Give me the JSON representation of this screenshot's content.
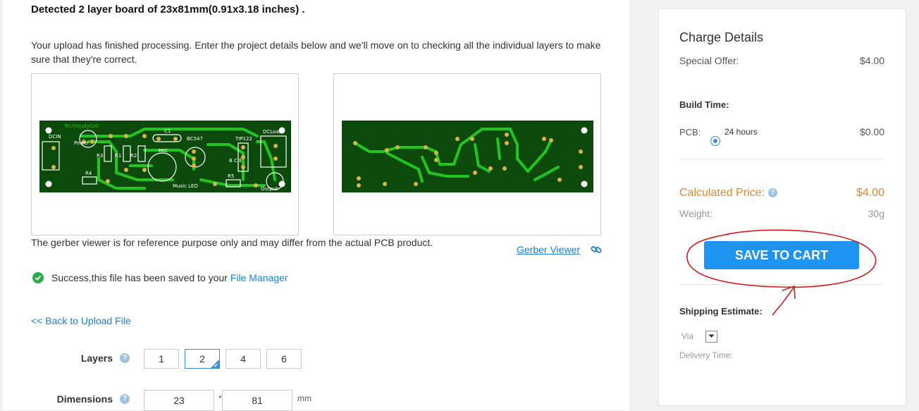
{
  "main": {
    "title": "Detected 2 layer board of 23x81mm(0.91x3.18 inches) .",
    "description": "Your upload has finished processing. Enter the project details below and we'll move on to checking all the individual layers to make sure that they're correct.",
    "pcb_top_labels": [
      "TechStudyCell",
      "DCIN",
      "Power",
      "C1",
      "BC547",
      "TIP122",
      "DCLoad",
      "R4",
      "R3",
      "R1",
      "R2",
      "MIC",
      "B C E",
      "R5",
      "Music LED",
      "Output"
    ],
    "note": "The gerber viewer is for reference purpose only and may differ from the actual PCB product.",
    "gerber_viewer_label": "Gerber Viewer",
    "success_text": "Success,this file has been saved to your",
    "file_manager_link": "File Manager",
    "back_link": "<< Back to Upload File",
    "layers": {
      "label": "Layers",
      "options": [
        "1",
        "2",
        "4",
        "6"
      ],
      "selected": "2"
    },
    "dimensions": {
      "label": "Dimensions",
      "width": "23",
      "height": "81",
      "separator": "*",
      "unit": "mm"
    },
    "help_icon_glyph": "?"
  },
  "sidebar": {
    "heading": "Charge Details",
    "special_offer_label": "Special Offer:",
    "special_offer_value": "$4.00",
    "build_time_label": "Build Time:",
    "pcb_label": "PCB:",
    "pcb_option": "24 hours",
    "pcb_value": "$0.00",
    "calculated_price_label": "Calculated Price:",
    "calculated_price_value": "$4.00",
    "weight_label": "Weight:",
    "weight_value": "30g",
    "save_to_cart_label": "SAVE TO CART",
    "shipping_estimate_label": "Shipping Estimate:",
    "via_label": "Via",
    "delivery_time_label": "Delivery Time:"
  },
  "colors": {
    "pcb_board": "#0b4a0b",
    "pcb_trace": "#22c41f",
    "pcb_pad": "#d8b547",
    "link_blue": "#1a7fd6",
    "button_blue": "#1e94f0",
    "price_orange": "#e0892a",
    "annotation_red": "#d41a1a"
  }
}
